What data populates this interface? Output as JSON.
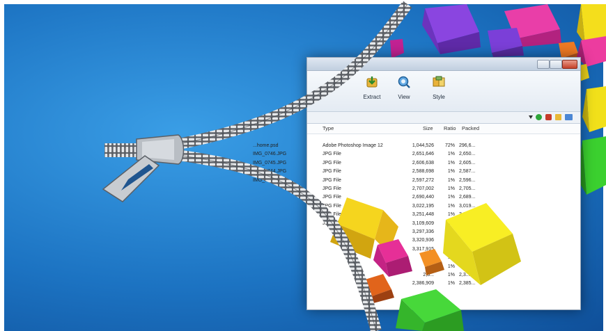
{
  "toolbar": {
    "extract_label": "Extract",
    "view_label": "View",
    "style_label": "Style"
  },
  "columns": {
    "type": "Type",
    "size": "Size",
    "ratio": "Ratio",
    "packed": "Packed"
  },
  "rows": [
    {
      "name": "...home.psd",
      "type": "Adobe Photoshop Image 12",
      "size": "1,044,526",
      "ratio": "72%",
      "packed": "296,6..."
    },
    {
      "name": "IMG_0746.JPG",
      "type": "JPG File",
      "size": "2,651,646",
      "ratio": "1%",
      "packed": "2,650..."
    },
    {
      "name": "IMG_0745.JPG",
      "type": "JPG File",
      "size": "2,606,638",
      "ratio": "1%",
      "packed": "2,605..."
    },
    {
      "name": "IMG_0744.JPG",
      "type": "JPG File",
      "size": "2,588,698",
      "ratio": "1%",
      "packed": "2,587..."
    },
    {
      "name": "IMG_0743.JPG",
      "type": "JPG File",
      "size": "2,597,272",
      "ratio": "1%",
      "packed": "2,596..."
    },
    {
      "name": "",
      "type": "JPG File",
      "size": "2,707,002",
      "ratio": "1%",
      "packed": "2,705..."
    },
    {
      "name": "",
      "type": "JPG File",
      "size": "2,690,440",
      "ratio": "1%",
      "packed": "2,689..."
    },
    {
      "name": "",
      "type": "JPG File",
      "size": "3,022,195",
      "ratio": "1%",
      "packed": "3,019..."
    },
    {
      "name": "",
      "type": "JPG File",
      "size": "3,251,448",
      "ratio": "1%",
      "packed": "3,2..."
    },
    {
      "name": "",
      "type": "JPG File",
      "size": "3,109,609",
      "ratio": "1%",
      "packed": ""
    },
    {
      "name": "",
      "type": "",
      "size": "3,297,336",
      "ratio": "",
      "packed": ""
    },
    {
      "name": "",
      "type": "",
      "size": "3,320,936",
      "ratio": "",
      "packed": ""
    },
    {
      "name": "",
      "type": "",
      "size": "3,317,915",
      "ratio": "1%",
      "packed": ""
    },
    {
      "name": "",
      "type": "",
      "size": "3,...",
      "ratio": "1%",
      "packed": ""
    },
    {
      "name": "",
      "type": "",
      "size": "2,...",
      "ratio": "1%",
      "packed": ""
    },
    {
      "name": "",
      "type": "",
      "size": "2,3...",
      "ratio": "1%",
      "packed": "2,3..."
    },
    {
      "name": "",
      "type": "",
      "size": "2,386,909",
      "ratio": "1%",
      "packed": "2,385..."
    }
  ],
  "colors": {
    "background_blue": "#1c73c2",
    "cube_yellow": "#f2e21a",
    "cube_magenta": "#d21c8f",
    "cube_green": "#37c92c",
    "cube_purple": "#7a3bd6",
    "cube_orange": "#e56d1b"
  },
  "icons": {
    "extract": "extract-icon",
    "view": "view-icon",
    "style": "style-icon"
  }
}
